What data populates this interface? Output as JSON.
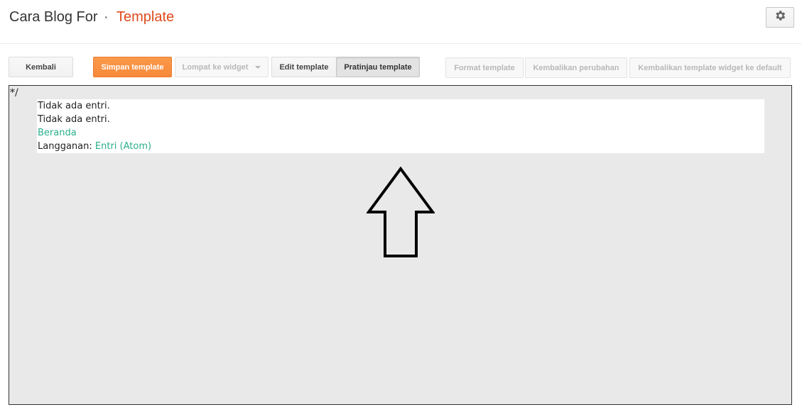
{
  "header": {
    "blog_name": "Cara Blog For",
    "separator": "·",
    "page_title": "Template",
    "settings_icon": "gear-icon"
  },
  "toolbar": {
    "back": "Kembali",
    "save_template": "Simpan template",
    "jump_to_widget": "Lompat ke widget",
    "edit_template": "Edit template",
    "preview_template": "Pratinjau template",
    "format_template": "Format template",
    "revert_changes": "Kembalikan perubahan",
    "revert_widget_default": "Kembalikan template widget ke default"
  },
  "preview": {
    "comment_end": "*/",
    "lines": {
      "no_entries_1": "Tidak ada entri.",
      "no_entries_2": "Tidak ada entri.",
      "home_link": "Beranda",
      "subscribe_label": "Langganan:",
      "subscribe_link": "Entri (Atom)"
    },
    "annotation_icon": "up-arrow-icon"
  },
  "colors": {
    "accent_orange": "#dd4b1b",
    "primary_button": "#f7883a",
    "link": "#2aaf8b",
    "preview_bg": "#e9e9e9"
  }
}
